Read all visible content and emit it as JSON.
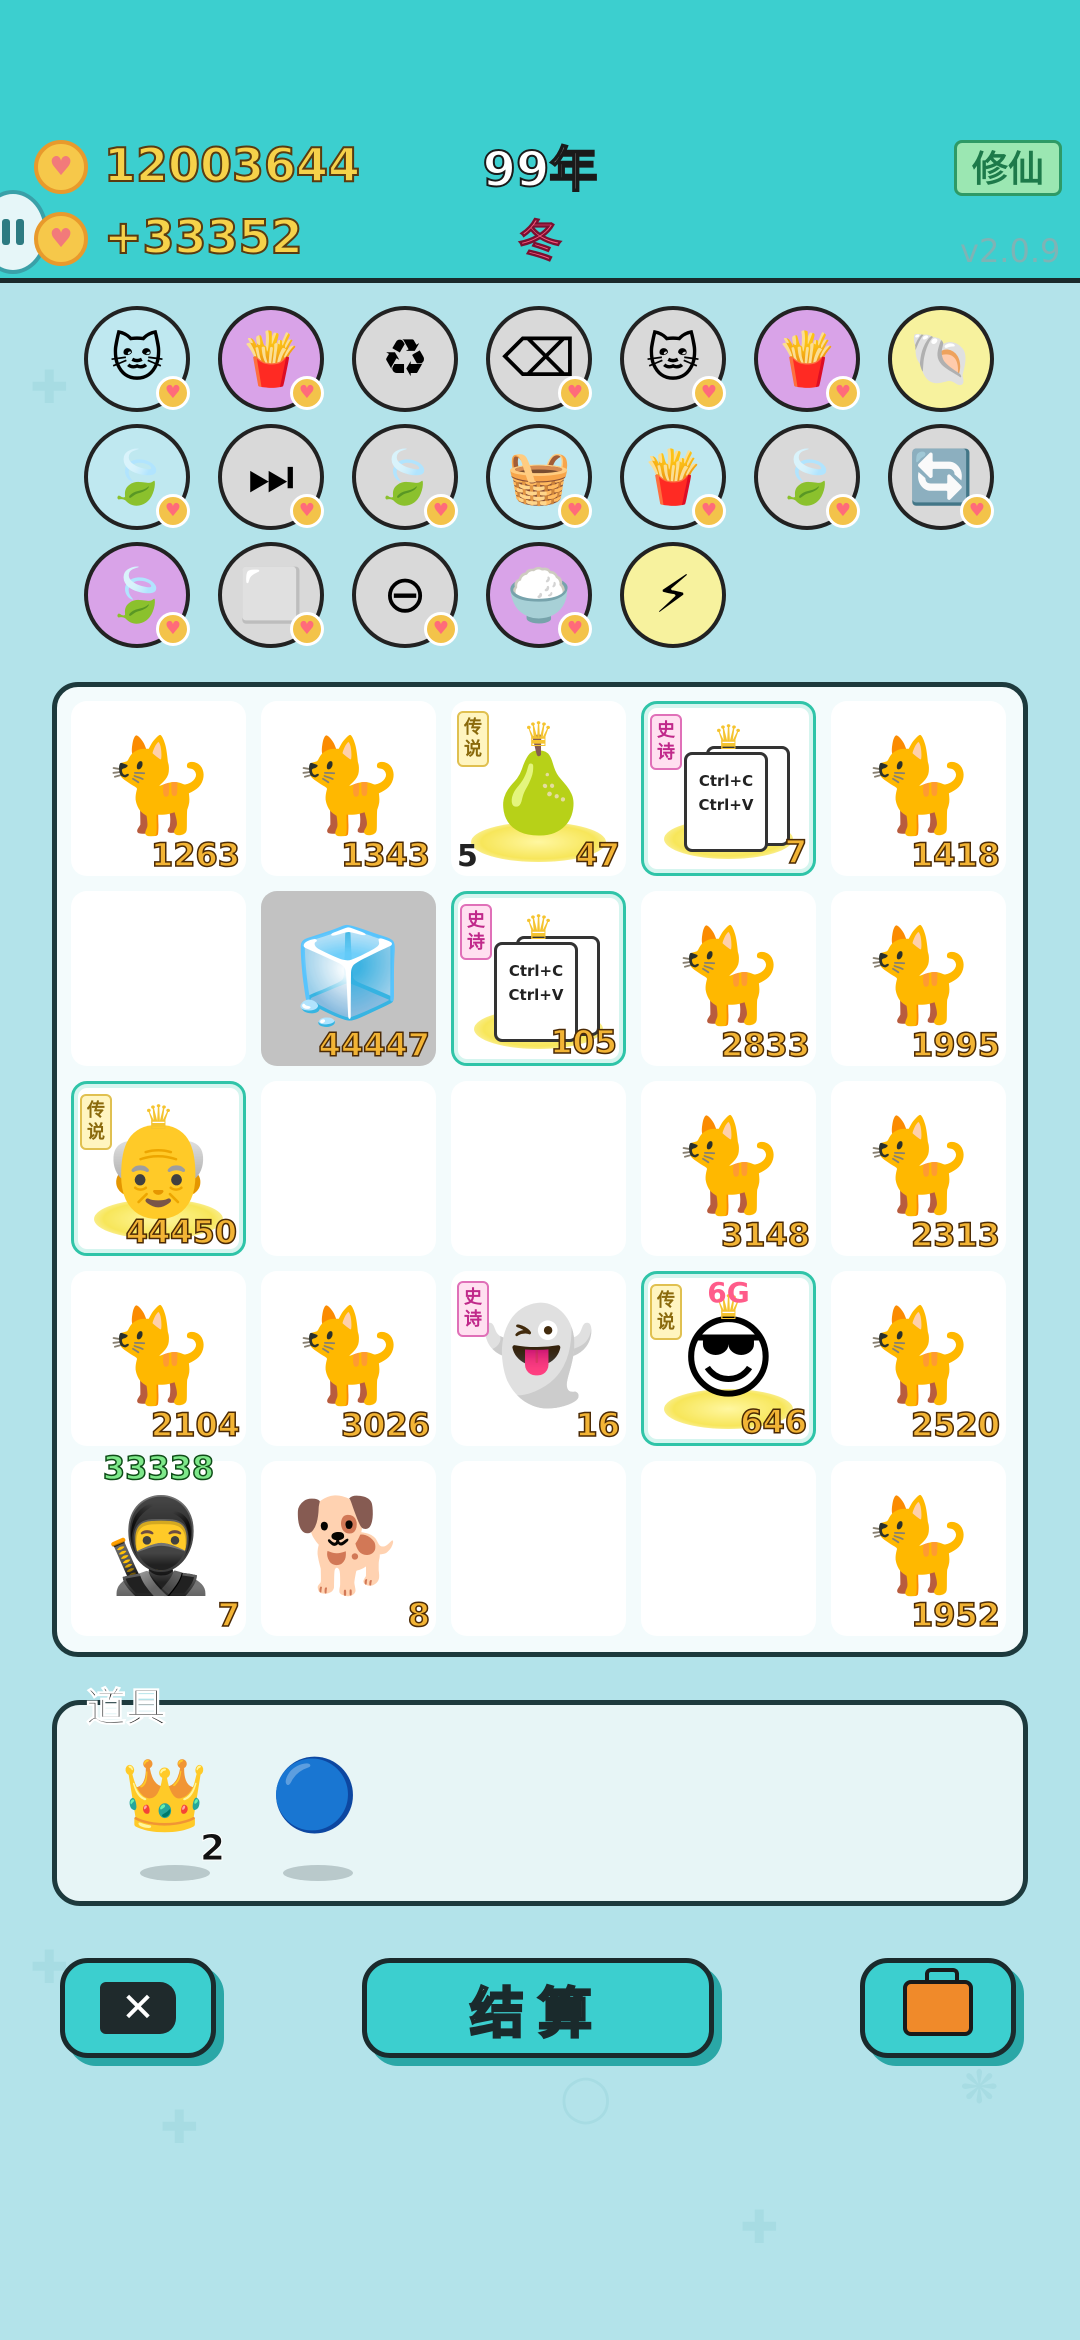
{
  "header": {
    "coins": "12003644",
    "income": "+33352",
    "year": "99年",
    "season": "冬",
    "cultivate_label": "修仙",
    "version": "v2.0.9"
  },
  "relics": [
    {
      "icon": "🐱",
      "bg": "#bfe8f0",
      "badge": true
    },
    {
      "icon": "🍟",
      "bg": "#d9a3e8",
      "badge": true
    },
    {
      "icon": "♻",
      "bg": "#d9d9d9",
      "badge": false
    },
    {
      "icon": "⌫",
      "bg": "#d9d9d9",
      "badge": true
    },
    {
      "icon": "🐱",
      "bg": "#d9d9d9",
      "badge": true
    },
    {
      "icon": "🍟",
      "bg": "#d9a3e8",
      "badge": true
    },
    {
      "icon": "🐚",
      "bg": "#f7f29e",
      "badge": false
    },
    {
      "icon": "🍃",
      "bg": "#bfe8f0",
      "badge": true
    },
    {
      "icon": "⏭",
      "bg": "#d9d9d9",
      "badge": true
    },
    {
      "icon": "🍃",
      "bg": "#d9d9d9",
      "badge": true
    },
    {
      "icon": "🧺",
      "bg": "#bfe8f0",
      "badge": true
    },
    {
      "icon": "🍟",
      "bg": "#bfe8f0",
      "badge": true
    },
    {
      "icon": "🍃",
      "bg": "#d9d9d9",
      "badge": true
    },
    {
      "icon": "🔄",
      "bg": "#d9d9d9",
      "badge": true
    },
    {
      "icon": "🍃",
      "bg": "#d9a3e8",
      "badge": true
    },
    {
      "icon": "⬜",
      "bg": "#d9d9d9",
      "badge": true
    },
    {
      "icon": "⊖",
      "bg": "#d9d9d9",
      "badge": true
    },
    {
      "icon": "🍚",
      "bg": "#d9a3e8",
      "badge": true
    },
    {
      "icon": "⚡",
      "bg": "#f7f29e",
      "badge": false
    }
  ],
  "board": [
    [
      {
        "type": "cat",
        "art": "🐈",
        "value": "1263"
      },
      {
        "type": "cat",
        "art": "🐈",
        "value": "1343"
      },
      {
        "type": "pear",
        "art": "🍐",
        "value": "47",
        "left": "5",
        "rarity": "传说",
        "rarity_kind": "legendary",
        "crown": true
      },
      {
        "type": "ctrl",
        "value": "7",
        "rarity": "史诗",
        "rarity_kind": "epic",
        "crown": true,
        "legend": true,
        "card_text": "Ctrl+C",
        "card_text2": "Ctrl+V"
      },
      {
        "type": "cat",
        "art": "🐈",
        "value": "1418"
      }
    ],
    [
      {
        "type": "empty"
      },
      {
        "type": "fridge",
        "art": "🧊",
        "value": "44447",
        "gray": true
      },
      {
        "type": "ctrl",
        "value": "105",
        "rarity": "史诗",
        "rarity_kind": "epic",
        "crown": true,
        "legend": true,
        "card_text": "Ctrl+C",
        "card_text2": "Ctrl+V"
      },
      {
        "type": "cat",
        "art": "🐈",
        "value": "2833"
      },
      {
        "type": "cat",
        "art": "🐈",
        "value": "1995"
      }
    ],
    [
      {
        "type": "grandpa",
        "art": "👴",
        "value": "44450",
        "rarity": "传说",
        "rarity_kind": "legendary",
        "crown": true,
        "legend": true
      },
      {
        "type": "empty"
      },
      {
        "type": "empty"
      },
      {
        "type": "cat",
        "art": "🐈",
        "value": "3148"
      },
      {
        "type": "cat",
        "art": "🐈",
        "value": "2313"
      }
    ],
    [
      {
        "type": "cat",
        "art": "🐈",
        "value": "2104"
      },
      {
        "type": "cat",
        "art": "🐈",
        "value": "3026"
      },
      {
        "type": "ghost",
        "art": "👻",
        "value": "16",
        "rarity": "史诗",
        "rarity_kind": "epic"
      },
      {
        "type": "boss",
        "art": "😎",
        "value": "646",
        "rarity": "传说",
        "rarity_kind": "legendary",
        "crown": true,
        "legend": true,
        "tag": "6G"
      },
      {
        "type": "cat",
        "art": "🐈",
        "value": "2520"
      }
    ],
    [
      {
        "type": "thief",
        "art": "🥷",
        "value": "7",
        "top": "33338"
      },
      {
        "type": "dog",
        "art": "🐕",
        "value": "8"
      },
      {
        "type": "empty"
      },
      {
        "type": "empty"
      },
      {
        "type": "cat",
        "art": "🐈",
        "value": "1952"
      }
    ]
  ],
  "items": {
    "title": "道具",
    "crown_count": "2",
    "list": [
      {
        "icon": "👑",
        "name": "crown"
      },
      {
        "icon": "🔵",
        "name": "blue-orb"
      }
    ]
  },
  "buttons": {
    "settle_label": "结算"
  },
  "colors": {
    "header": "#3ccfcf",
    "background": "#b3e3ea",
    "number": "#f2b435"
  }
}
